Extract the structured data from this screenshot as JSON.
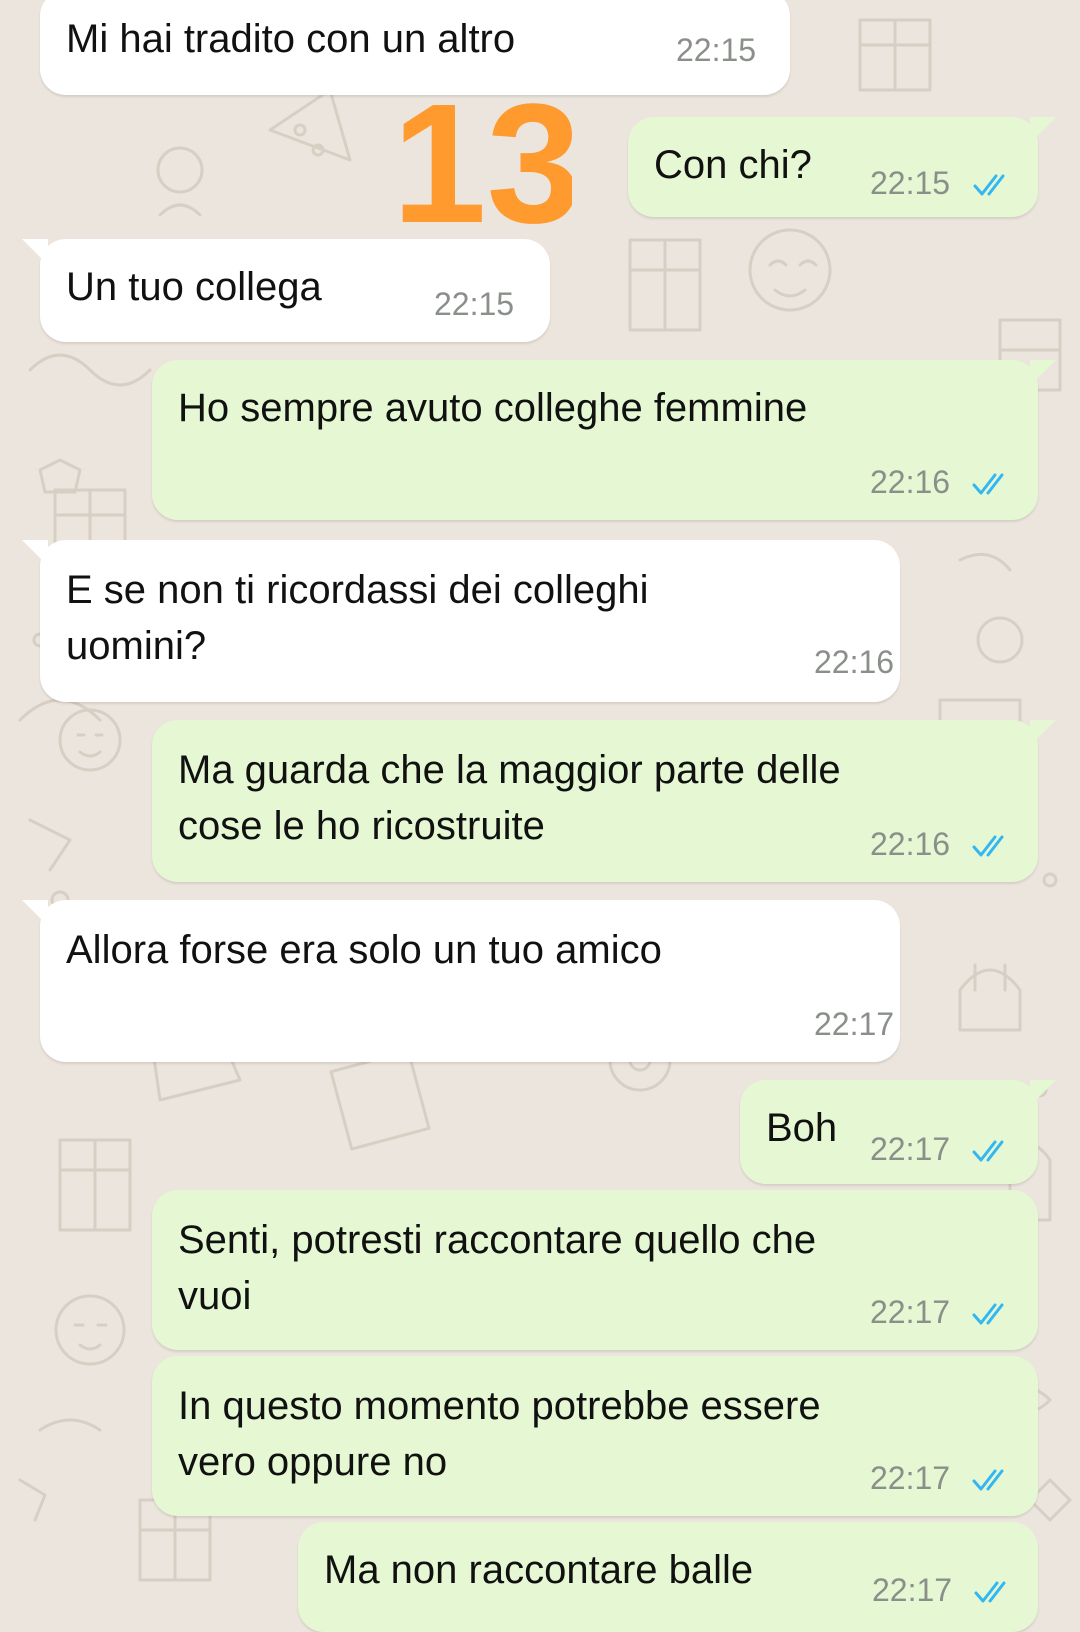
{
  "colors": {
    "incoming_bubble": "#ffffff",
    "outgoing_bubble": "#e5f8d3",
    "read_ticks": "#34b7f1",
    "timestamp": "#8a8f8a",
    "background": "#ece5dd",
    "sticker": "#ff9a2e"
  },
  "sticker": {
    "text": "13"
  },
  "messages": [
    {
      "from": "contact",
      "text": "Mi hai tradito con un altro",
      "time": "22:15"
    },
    {
      "from": "me",
      "text": "Con chi?",
      "time": "22:15",
      "status": "read",
      "status_icon": "double-check-icon"
    },
    {
      "from": "contact",
      "text": "Un tuo collega",
      "time": "22:15"
    },
    {
      "from": "me",
      "text": "Ho sempre avuto colleghe femmine",
      "time": "22:16",
      "status": "read",
      "status_icon": "double-check-icon"
    },
    {
      "from": "contact",
      "text": "E se non ti ricordassi dei colleghi\nuomini?",
      "time": "22:16"
    },
    {
      "from": "me",
      "text": "Ma guarda che la maggior parte delle\ncose le ho ricostruite",
      "time": "22:16",
      "status": "read",
      "status_icon": "double-check-icon"
    },
    {
      "from": "contact",
      "text": "Allora forse era solo un tuo amico",
      "time": "22:17"
    },
    {
      "from": "me",
      "text": "Boh",
      "time": "22:17",
      "status": "read",
      "status_icon": "double-check-icon"
    },
    {
      "from": "me",
      "text": "Senti, potresti raccontare quello che\nvuoi",
      "time": "22:17",
      "status": "read",
      "status_icon": "double-check-icon"
    },
    {
      "from": "me",
      "text": "In questo momento potrebbe essere\nvero oppure no",
      "time": "22:17",
      "status": "read",
      "status_icon": "double-check-icon"
    },
    {
      "from": "me",
      "text": "Ma non raccontare balle",
      "time": "22:17",
      "status": "read",
      "status_icon": "double-check-icon"
    }
  ]
}
